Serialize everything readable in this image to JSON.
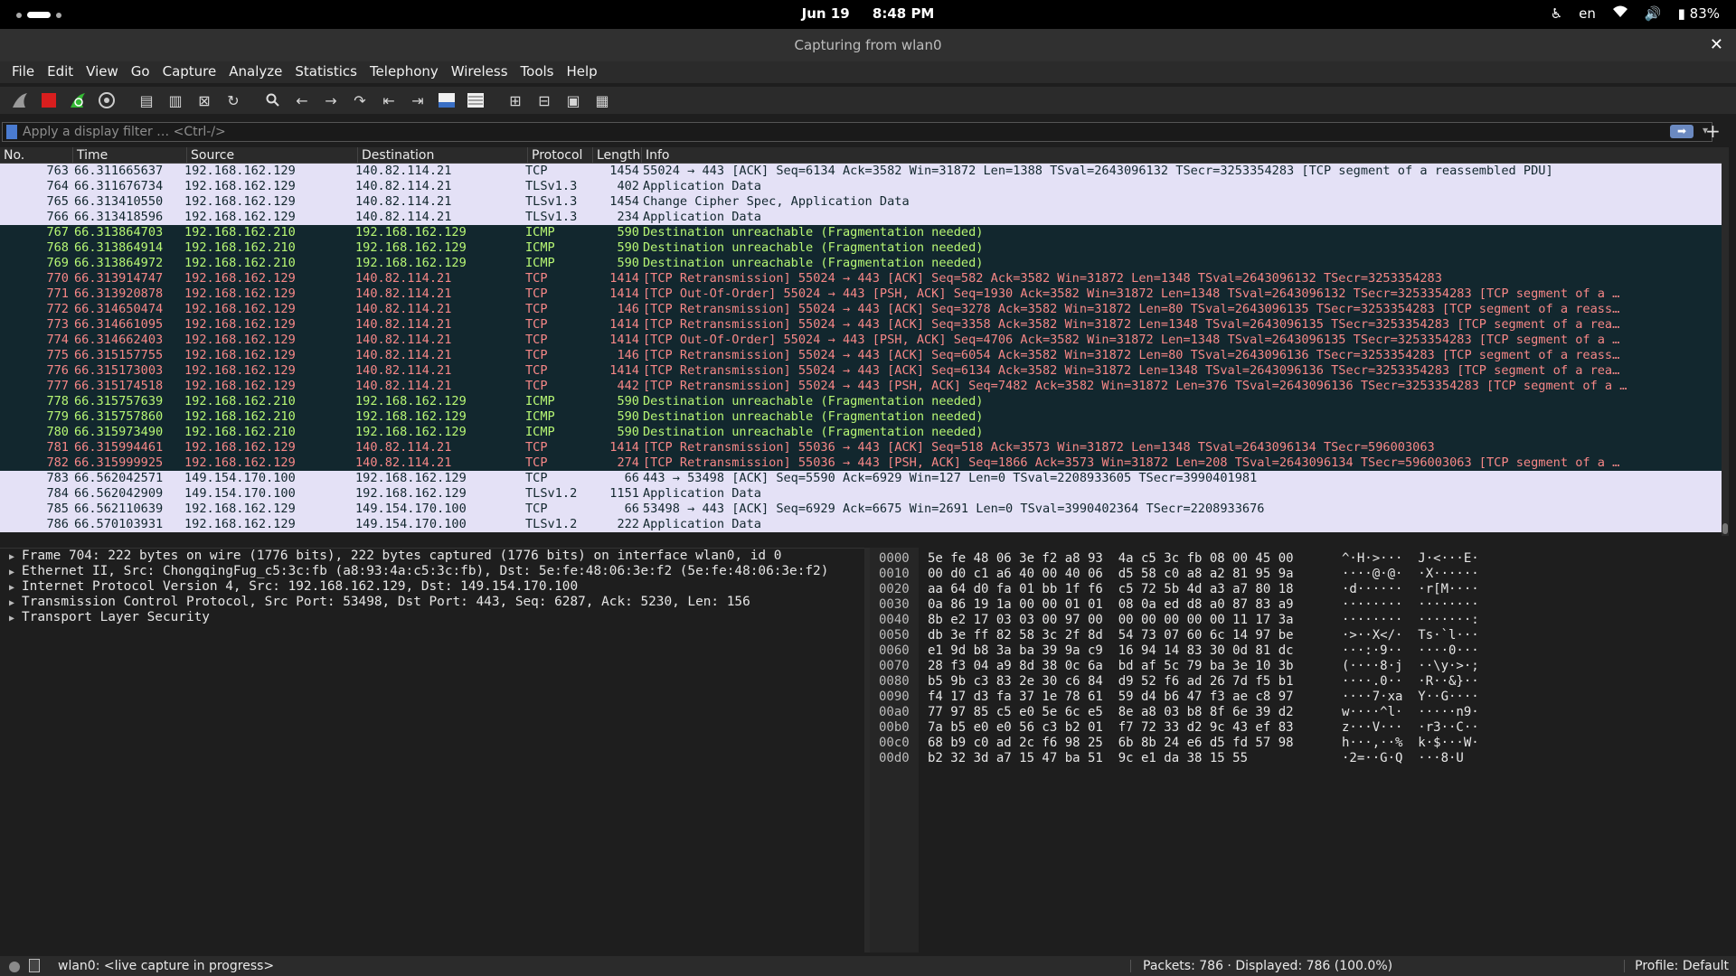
{
  "topbar": {
    "date": "Jun 19",
    "time": "8:48 PM",
    "language": "en",
    "battery": "83%"
  },
  "window": {
    "title": "Capturing from wlan0"
  },
  "menu": [
    "File",
    "Edit",
    "View",
    "Go",
    "Capture",
    "Analyze",
    "Statistics",
    "Telephony",
    "Wireless",
    "Tools",
    "Help"
  ],
  "toolbar_icons": [
    "shark-fin-icon",
    "stop-capture-icon",
    "restart-capture-icon",
    "capture-options-icon",
    "open-file-icon",
    "save-file-icon",
    "close-file-icon",
    "reload-file-icon",
    "find-packet-icon",
    "go-back-icon",
    "go-forward-icon",
    "go-to-packet-icon",
    "go-first-icon",
    "go-last-icon",
    "autoscroll-icon",
    "colorize-icon",
    "zoom-in-icon",
    "zoom-out-icon",
    "normal-size-icon",
    "resize-columns-icon"
  ],
  "filter": {
    "placeholder": "Apply a display filter … <Ctrl-/>"
  },
  "columns": [
    "No.",
    "Time",
    "Source",
    "Destination",
    "Protocol",
    "Length",
    "Info"
  ],
  "colors": {
    "row_normal_bg": "#e4e1f6",
    "row_dark_bg": "#12272e",
    "icmp_text": "#b7f774",
    "bad_tcp_text": "#f78787"
  },
  "packets": [
    {
      "no": "763",
      "time": "66.311665637",
      "src": "192.168.162.129",
      "dst": "140.82.114.21",
      "proto": "TCP",
      "len": "1454",
      "info": "55024 → 443 [ACK] Seq=6134 Ack=3582 Win=31872 Len=1388 TSval=2643096132 TSecr=3253354283 [TCP segment of a reassembled PDU]",
      "style": "normal"
    },
    {
      "no": "764",
      "time": "66.311676734",
      "src": "192.168.162.129",
      "dst": "140.82.114.21",
      "proto": "TLSv1.3",
      "len": "402",
      "info": "Application Data",
      "style": "normal"
    },
    {
      "no": "765",
      "time": "66.313410550",
      "src": "192.168.162.129",
      "dst": "140.82.114.21",
      "proto": "TLSv1.3",
      "len": "1454",
      "info": "Change Cipher Spec, Application Data",
      "style": "normal"
    },
    {
      "no": "766",
      "time": "66.313418596",
      "src": "192.168.162.129",
      "dst": "140.82.114.21",
      "proto": "TLSv1.3",
      "len": "234",
      "info": "Application Data",
      "style": "normal"
    },
    {
      "no": "767",
      "time": "66.313864703",
      "src": "192.168.162.210",
      "dst": "192.168.162.129",
      "proto": "ICMP",
      "len": "590",
      "info": "Destination unreachable (Fragmentation needed)",
      "style": "icmp"
    },
    {
      "no": "768",
      "time": "66.313864914",
      "src": "192.168.162.210",
      "dst": "192.168.162.129",
      "proto": "ICMP",
      "len": "590",
      "info": "Destination unreachable (Fragmentation needed)",
      "style": "icmp"
    },
    {
      "no": "769",
      "time": "66.313864972",
      "src": "192.168.162.210",
      "dst": "192.168.162.129",
      "proto": "ICMP",
      "len": "590",
      "info": "Destination unreachable (Fragmentation needed)",
      "style": "icmp"
    },
    {
      "no": "770",
      "time": "66.313914747",
      "src": "192.168.162.129",
      "dst": "140.82.114.21",
      "proto": "TCP",
      "len": "1414",
      "info": "[TCP Retransmission] 55024 → 443 [ACK] Seq=582 Ack=3582 Win=31872 Len=1348 TSval=2643096132 TSecr=3253354283",
      "style": "bad"
    },
    {
      "no": "771",
      "time": "66.313920878",
      "src": "192.168.162.129",
      "dst": "140.82.114.21",
      "proto": "TCP",
      "len": "1414",
      "info": "[TCP Out-Of-Order] 55024 → 443 [PSH, ACK] Seq=1930 Ack=3582 Win=31872 Len=1348 TSval=2643096132 TSecr=3253354283 [TCP segment of a …",
      "style": "bad"
    },
    {
      "no": "772",
      "time": "66.314650474",
      "src": "192.168.162.129",
      "dst": "140.82.114.21",
      "proto": "TCP",
      "len": "146",
      "info": "[TCP Retransmission] 55024 → 443 [ACK] Seq=3278 Ack=3582 Win=31872 Len=80 TSval=2643096135 TSecr=3253354283 [TCP segment of a reass…",
      "style": "bad"
    },
    {
      "no": "773",
      "time": "66.314661095",
      "src": "192.168.162.129",
      "dst": "140.82.114.21",
      "proto": "TCP",
      "len": "1414",
      "info": "[TCP Retransmission] 55024 → 443 [ACK] Seq=3358 Ack=3582 Win=31872 Len=1348 TSval=2643096135 TSecr=3253354283 [TCP segment of a rea…",
      "style": "bad"
    },
    {
      "no": "774",
      "time": "66.314662403",
      "src": "192.168.162.129",
      "dst": "140.82.114.21",
      "proto": "TCP",
      "len": "1414",
      "info": "[TCP Out-Of-Order] 55024 → 443 [PSH, ACK] Seq=4706 Ack=3582 Win=31872 Len=1348 TSval=2643096135 TSecr=3253354283 [TCP segment of a …",
      "style": "bad"
    },
    {
      "no": "775",
      "time": "66.315157755",
      "src": "192.168.162.129",
      "dst": "140.82.114.21",
      "proto": "TCP",
      "len": "146",
      "info": "[TCP Retransmission] 55024 → 443 [ACK] Seq=6054 Ack=3582 Win=31872 Len=80 TSval=2643096136 TSecr=3253354283 [TCP segment of a reass…",
      "style": "bad"
    },
    {
      "no": "776",
      "time": "66.315173003",
      "src": "192.168.162.129",
      "dst": "140.82.114.21",
      "proto": "TCP",
      "len": "1414",
      "info": "[TCP Retransmission] 55024 → 443 [ACK] Seq=6134 Ack=3582 Win=31872 Len=1348 TSval=2643096136 TSecr=3253354283 [TCP segment of a rea…",
      "style": "bad"
    },
    {
      "no": "777",
      "time": "66.315174518",
      "src": "192.168.162.129",
      "dst": "140.82.114.21",
      "proto": "TCP",
      "len": "442",
      "info": "[TCP Retransmission] 55024 → 443 [PSH, ACK] Seq=7482 Ack=3582 Win=31872 Len=376 TSval=2643096136 TSecr=3253354283 [TCP segment of a …",
      "style": "bad"
    },
    {
      "no": "778",
      "time": "66.315757639",
      "src": "192.168.162.210",
      "dst": "192.168.162.129",
      "proto": "ICMP",
      "len": "590",
      "info": "Destination unreachable (Fragmentation needed)",
      "style": "icmp"
    },
    {
      "no": "779",
      "time": "66.315757860",
      "src": "192.168.162.210",
      "dst": "192.168.162.129",
      "proto": "ICMP",
      "len": "590",
      "info": "Destination unreachable (Fragmentation needed)",
      "style": "icmp"
    },
    {
      "no": "780",
      "time": "66.315973490",
      "src": "192.168.162.210",
      "dst": "192.168.162.129",
      "proto": "ICMP",
      "len": "590",
      "info": "Destination unreachable (Fragmentation needed)",
      "style": "icmp"
    },
    {
      "no": "781",
      "time": "66.315994461",
      "src": "192.168.162.129",
      "dst": "140.82.114.21",
      "proto": "TCP",
      "len": "1414",
      "info": "[TCP Retransmission] 55036 → 443 [ACK] Seq=518 Ack=3573 Win=31872 Len=1348 TSval=2643096134 TSecr=596003063",
      "style": "bad"
    },
    {
      "no": "782",
      "time": "66.315999925",
      "src": "192.168.162.129",
      "dst": "140.82.114.21",
      "proto": "TCP",
      "len": "274",
      "info": "[TCP Retransmission] 55036 → 443 [PSH, ACK] Seq=1866 Ack=3573 Win=31872 Len=208 TSval=2643096134 TSecr=596003063 [TCP segment of a …",
      "style": "bad"
    },
    {
      "no": "783",
      "time": "66.562042571",
      "src": "149.154.170.100",
      "dst": "192.168.162.129",
      "proto": "TCP",
      "len": "66",
      "info": "443 → 53498 [ACK] Seq=5590 Ack=6929 Win=127 Len=0 TSval=2208933605 TSecr=3990401981",
      "style": "normal"
    },
    {
      "no": "784",
      "time": "66.562042909",
      "src": "149.154.170.100",
      "dst": "192.168.162.129",
      "proto": "TLSv1.2",
      "len": "1151",
      "info": "Application Data",
      "style": "normal"
    },
    {
      "no": "785",
      "time": "66.562110639",
      "src": "192.168.162.129",
      "dst": "149.154.170.100",
      "proto": "TCP",
      "len": "66",
      "info": "53498 → 443 [ACK] Seq=6929 Ack=6675 Win=2691 Len=0 TSval=3990402364 TSecr=2208933676",
      "style": "normal"
    },
    {
      "no": "786",
      "time": "66.570103931",
      "src": "192.168.162.129",
      "dst": "149.154.170.100",
      "proto": "TLSv1.2",
      "len": "222",
      "info": "Application Data",
      "style": "normal"
    }
  ],
  "details": [
    "Frame 704: 222 bytes on wire (1776 bits), 222 bytes captured (1776 bits) on interface wlan0, id 0",
    "Ethernet II, Src: ChongqingFug_c5:3c:fb (a8:93:4a:c5:3c:fb), Dst: 5e:fe:48:06:3e:f2 (5e:fe:48:06:3e:f2)",
    "Internet Protocol Version 4, Src: 192.168.162.129, Dst: 149.154.170.100",
    "Transmission Control Protocol, Src Port: 53498, Dst Port: 443, Seq: 6287, Ack: 5230, Len: 156",
    "Transport Layer Security"
  ],
  "bytes": [
    {
      "off": "0000",
      "hex": "5e fe 48 06 3e f2 a8 93  4a c5 3c fb 08 00 45 00",
      "ascii": "^·H·>···  J·<···E·"
    },
    {
      "off": "0010",
      "hex": "00 d0 c1 a6 40 00 40 06  d5 58 c0 a8 a2 81 95 9a",
      "ascii": "····@·@·  ·X······"
    },
    {
      "off": "0020",
      "hex": "aa 64 d0 fa 01 bb 1f f6  c5 72 5b 4d a3 a7 80 18",
      "ascii": "·d······  ·r[M····"
    },
    {
      "off": "0030",
      "hex": "0a 86 19 1a 00 00 01 01  08 0a ed d8 a0 87 83 a9",
      "ascii": "········  ········"
    },
    {
      "off": "0040",
      "hex": "8b e2 17 03 03 00 97 00  00 00 00 00 00 11 17 3a",
      "ascii": "········  ·······:"
    },
    {
      "off": "0050",
      "hex": "db 3e ff 82 58 3c 2f 8d  54 73 07 60 6c 14 97 be",
      "ascii": "·>··X</·  Ts·`l···"
    },
    {
      "off": "0060",
      "hex": "e1 9d b8 3a ba 39 9a c9  16 94 14 83 30 0d 81 dc",
      "ascii": "···:·9··  ····0···"
    },
    {
      "off": "0070",
      "hex": "28 f3 04 a9 8d 38 0c 6a  bd af 5c 79 ba 3e 10 3b",
      "ascii": "(····8·j  ··\\y·>·;"
    },
    {
      "off": "0080",
      "hex": "b5 9b c3 83 2e 30 c6 84  d9 52 f6 ad 26 7d f5 b1",
      "ascii": "····.0··  ·R··&}··"
    },
    {
      "off": "0090",
      "hex": "f4 17 d3 fa 37 1e 78 61  59 d4 b6 47 f3 ae c8 97",
      "ascii": "····7·xa  Y··G····"
    },
    {
      "off": "00a0",
      "hex": "77 97 85 c5 e0 5e 6c e5  8e a8 03 b8 8f 6e 39 d2",
      "ascii": "w····^l·  ·····n9·"
    },
    {
      "off": "00b0",
      "hex": "7a b5 e0 e0 56 c3 b2 01  f7 72 33 d2 9c 43 ef 83",
      "ascii": "z···V···  ·r3··C··"
    },
    {
      "off": "00c0",
      "hex": "68 b9 c0 ad 2c f6 98 25  6b 8b 24 e6 d5 fd 57 98",
      "ascii": "h···,··%  k·$···W·"
    },
    {
      "off": "00d0",
      "hex": "b2 32 3d a7 15 47 ba 51  9c e1 da 38 15 55",
      "ascii": "·2=··G·Q  ···8·U"
    }
  ],
  "status": {
    "message": "wlan0: <live capture in progress>",
    "packets": "Packets: 786 · Displayed: 786 (100.0%)",
    "profile": "Profile: Default"
  }
}
